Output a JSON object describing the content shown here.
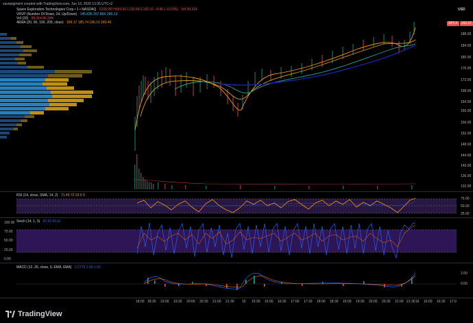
{
  "header": {
    "created_by": "savepigiment created with TradingView.com, Jun 16, 2026 13:35 UTC+2",
    "symbol_line": "Space Exploration Technologies Corp • 1 • NASDAQ",
    "ohlc": "O192.80 H193.00 L192.09 C192.37 −0.45 (−0.23%)",
    "volume_line": "Vol 99.314",
    "vrvp": "VRVP (Number Of Rows, 24, Up/Down)",
    "vrvp_values": "145.835  207.85K  280.13",
    "vol20": "Vol (20)",
    "vol20_values": "99.314  86.24K",
    "ema": "4EMA (20, 50, 100, 200, close)",
    "ema_values": "189.17  185.74  186.19  183.46"
  },
  "currency": "USD",
  "symbol_badge": "SPCX",
  "last_price": "192.37",
  "price_ticks": [
    "188.00",
    "184.00",
    "180.00",
    "176.00",
    "172.00",
    "168.00",
    "164.00",
    "160.00",
    "156.00",
    "152.00",
    "148.00",
    "144.00",
    "140.00",
    "136.00",
    "132.00"
  ],
  "time_ticks": [
    "18:00",
    "18:30",
    "19:00",
    "19:30",
    "20:00",
    "20:30",
    "21:00",
    "21:30",
    "15",
    "15:30",
    "16:00",
    "16:30",
    "17:00",
    "17:30",
    "18:00",
    "18:30",
    "19:00",
    "19:30",
    "20:00",
    "20:30",
    "21:00",
    "21:30",
    "16",
    "16:00",
    "16:30",
    "17:0"
  ],
  "rsi": {
    "label": "RSI (14, close, SMA, 14, 2)",
    "values": "71.45  72.33  0  0",
    "ticks": [
      "75.00",
      "50.00",
      "25.00"
    ]
  },
  "stoch": {
    "label": "Stoch (14, 1, 3)",
    "values": "87.93  95.61",
    "ticks": [
      "100.00",
      "75.00",
      "50.00",
      "25.00",
      "0.00"
    ]
  },
  "macd": {
    "label": "MACD (12, 26, close, 9, EMA, EMA)",
    "values": "0.2770  1.90  1.63",
    "ticks": [
      "2.00",
      "0.00"
    ]
  },
  "brand": "TradingView",
  "colors": {
    "background": "#000000",
    "ema20": "#f7931a",
    "ema50": "#d4a017",
    "ema100": "#26a69a",
    "ema200": "#1e22aa",
    "rsi_line": "#ff9800",
    "stoch_k": "#2962ff",
    "stoch_d": "#ff6d00",
    "band": "#7e57c2"
  }
}
